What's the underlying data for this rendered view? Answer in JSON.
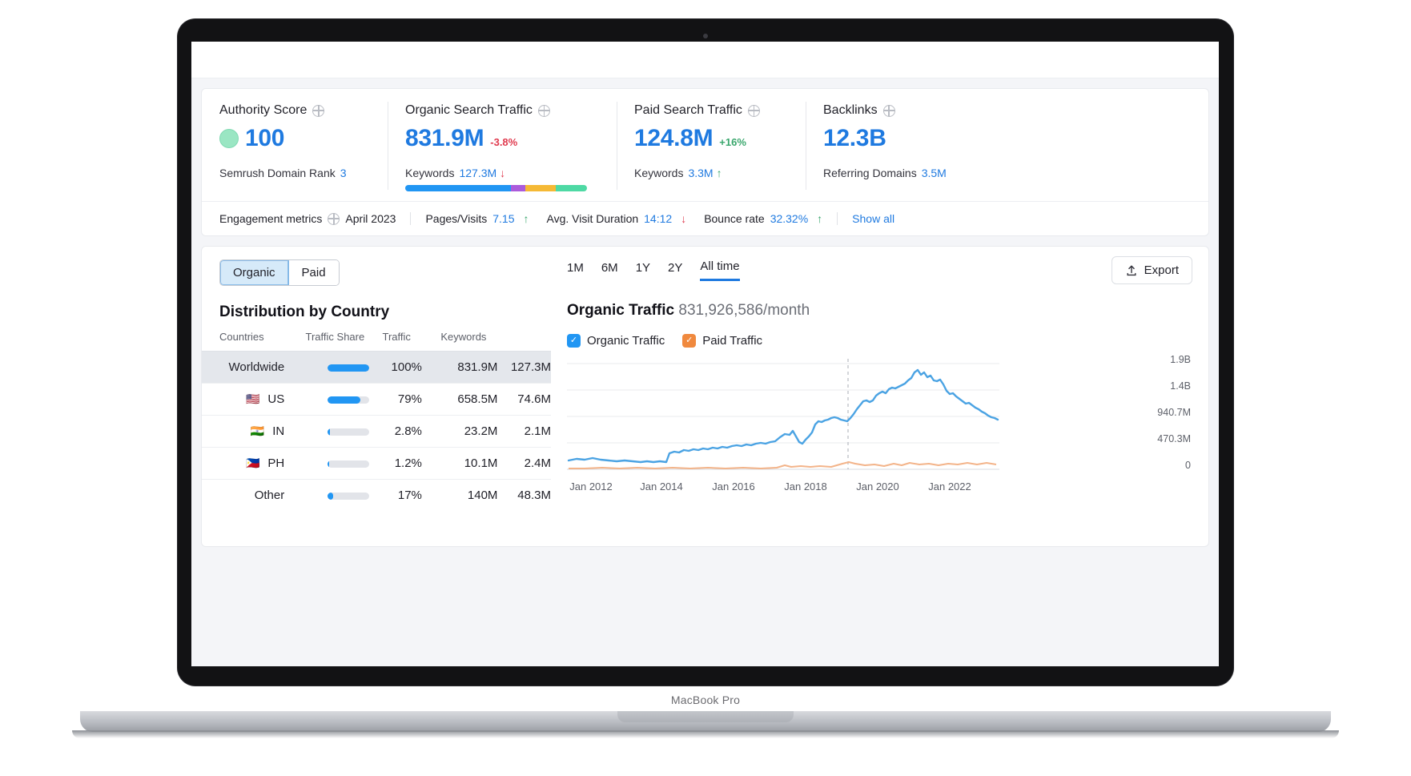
{
  "device": {
    "label": "MacBook Pro"
  },
  "metrics": [
    {
      "name": "authority-score",
      "title": "Authority Score",
      "value": "100",
      "delta": "",
      "sub_label": "Semrush Domain Rank",
      "sub_value": "3",
      "badge_color": "#9ae6c3"
    },
    {
      "name": "organic-search-traffic",
      "title": "Organic Search Traffic",
      "value": "831.9M",
      "delta": "-3.8%",
      "delta_dir": "down",
      "sub_label": "Keywords",
      "sub_value": "127.3M",
      "sub_arrow": "↓",
      "sub_arrow_dir": "down"
    },
    {
      "name": "paid-search-traffic",
      "title": "Paid Search Traffic",
      "value": "124.8M",
      "delta": "+16%",
      "delta_dir": "up",
      "sub_label": "Keywords",
      "sub_value": "3.3M",
      "sub_arrow": "↑",
      "sub_arrow_dir": "up"
    },
    {
      "name": "backlinks",
      "title": "Backlinks",
      "value": "12.3B",
      "delta": "",
      "sub_label": "Referring Domains",
      "sub_value": "3.5M"
    }
  ],
  "keyword_bar": [
    {
      "color": "#2196f3",
      "pct": 58
    },
    {
      "color": "#ab5bdb",
      "pct": 8
    },
    {
      "color": "#f5b935",
      "pct": 17
    },
    {
      "color": "#4ed9a4",
      "pct": 17
    }
  ],
  "engagement": {
    "label": "Engagement metrics",
    "period": "April 2023",
    "items": [
      {
        "label": "Pages/Visits",
        "value": "7.15",
        "arrow": "↑",
        "dir": "up"
      },
      {
        "label": "Avg. Visit Duration",
        "value": "14:12",
        "arrow": "↓",
        "dir": "down"
      },
      {
        "label": "Bounce rate",
        "value": "32.32%",
        "arrow": "↑",
        "dir": "up"
      }
    ],
    "show_all": "Show all"
  },
  "segmented": {
    "organic": "Organic",
    "paid": "Paid",
    "active": "Organic"
  },
  "distribution": {
    "title": "Distribution by Country",
    "columns": [
      "Countries",
      "Traffic Share",
      "Traffic",
      "Keywords"
    ],
    "rows": [
      {
        "flag": "",
        "country": "Worldwide",
        "share_pct": 100,
        "share": "100%",
        "traffic": "831.9M",
        "keywords": "127.3M",
        "highlight": true,
        "link": false
      },
      {
        "flag": "🇺🇸",
        "country": "US",
        "share_pct": 79,
        "share": "79%",
        "traffic": "658.5M",
        "keywords": "74.6M",
        "highlight": false,
        "link": true
      },
      {
        "flag": "🇮🇳",
        "country": "IN",
        "share_pct": 6,
        "share": "2.8%",
        "traffic": "23.2M",
        "keywords": "2.1M",
        "highlight": false,
        "link": true
      },
      {
        "flag": "🇵🇭",
        "country": "PH",
        "share_pct": 4,
        "share": "1.2%",
        "traffic": "10.1M",
        "keywords": "2.4M",
        "highlight": false,
        "link": true
      },
      {
        "flag": "",
        "country": "Other",
        "share_pct": 14,
        "share": "17%",
        "traffic": "140M",
        "keywords": "48.3M",
        "highlight": false,
        "link": false
      }
    ]
  },
  "ranges": {
    "items": [
      "1M",
      "6M",
      "1Y",
      "2Y",
      "All time"
    ],
    "active": "All time"
  },
  "export": {
    "label": "Export",
    "icon": "upload-icon"
  },
  "chart_header": {
    "title": "Organic Traffic",
    "value": "831,926,586/month"
  },
  "legend": [
    {
      "label": "Organic Traffic",
      "color": "#2196f3",
      "checked": true
    },
    {
      "label": "Paid Traffic",
      "color": "#f0893e",
      "checked": true
    }
  ],
  "chart_data": {
    "type": "line",
    "title": "Organic Traffic",
    "xlabel": "",
    "ylabel": "",
    "ylim": [
      0,
      2100000000
    ],
    "grid": true,
    "legend_position": "top",
    "y_ticks": [
      "0",
      "470.3M",
      "940.7M",
      "1.4B",
      "1.9B"
    ],
    "y_tick_values": [
      0,
      470300000,
      940700000,
      1400000000,
      1900000000
    ],
    "x_ticks": [
      "Jan 2012",
      "Jan 2014",
      "Jan 2016",
      "Jan 2018",
      "Jan 2020",
      "Jan 2022"
    ],
    "x_range": [
      "Jan 2011",
      "Jan 2023"
    ],
    "marker_line_x": "Jan 2019",
    "series": [
      {
        "name": "Organic Traffic",
        "color": "#4ba3e3",
        "x": [
          "2011-06",
          "2011-09",
          "2011-12",
          "2012-03",
          "2012-06",
          "2012-09",
          "2012-12",
          "2013-03",
          "2013-06",
          "2013-09",
          "2013-12",
          "2014-03",
          "2014-06",
          "2014-09",
          "2014-12",
          "2015-03",
          "2015-06",
          "2015-09",
          "2015-12",
          "2016-03",
          "2016-06",
          "2016-09",
          "2016-12",
          "2017-03",
          "2017-06",
          "2017-09",
          "2017-12",
          "2018-03",
          "2018-06",
          "2018-09",
          "2018-12",
          "2019-03",
          "2019-06",
          "2019-09",
          "2019-12",
          "2020-03",
          "2020-06",
          "2020-09",
          "2020-12",
          "2021-03",
          "2021-06",
          "2021-09",
          "2021-12",
          "2022-03",
          "2022-06",
          "2022-09",
          "2022-12"
        ],
        "values": [
          150000000,
          160000000,
          158000000,
          155000000,
          152000000,
          150000000,
          148000000,
          150000000,
          255000000,
          270000000,
          285000000,
          300000000,
          310000000,
          320000000,
          335000000,
          345000000,
          360000000,
          375000000,
          385000000,
          400000000,
          430000000,
          520000000,
          545000000,
          470000000,
          520000000,
          700000000,
          730000000,
          760000000,
          790000000,
          720000000,
          760000000,
          880000000,
          1020000000,
          1090000000,
          1060000000,
          1200000000,
          1330000000,
          1430000000,
          1480000000,
          1420000000,
          1560000000,
          1850000000,
          1760000000,
          1700000000,
          1620000000,
          1300000000,
          1120000000
        ]
      },
      {
        "name": "Paid Traffic",
        "color": "#f3b48a",
        "x": [
          "2011-06",
          "2012-06",
          "2013-06",
          "2014-06",
          "2015-06",
          "2016-06",
          "2017-06",
          "2018-06",
          "2018-12",
          "2019-03",
          "2019-09",
          "2020-03",
          "2020-09",
          "2021-03",
          "2021-09",
          "2022-03",
          "2022-12"
        ],
        "values": [
          15000000,
          16000000,
          18000000,
          17000000,
          19000000,
          18000000,
          20000000,
          60000000,
          45000000,
          95000000,
          75000000,
          60000000,
          90000000,
          70000000,
          85000000,
          65000000,
          95000000
        ]
      }
    ]
  }
}
